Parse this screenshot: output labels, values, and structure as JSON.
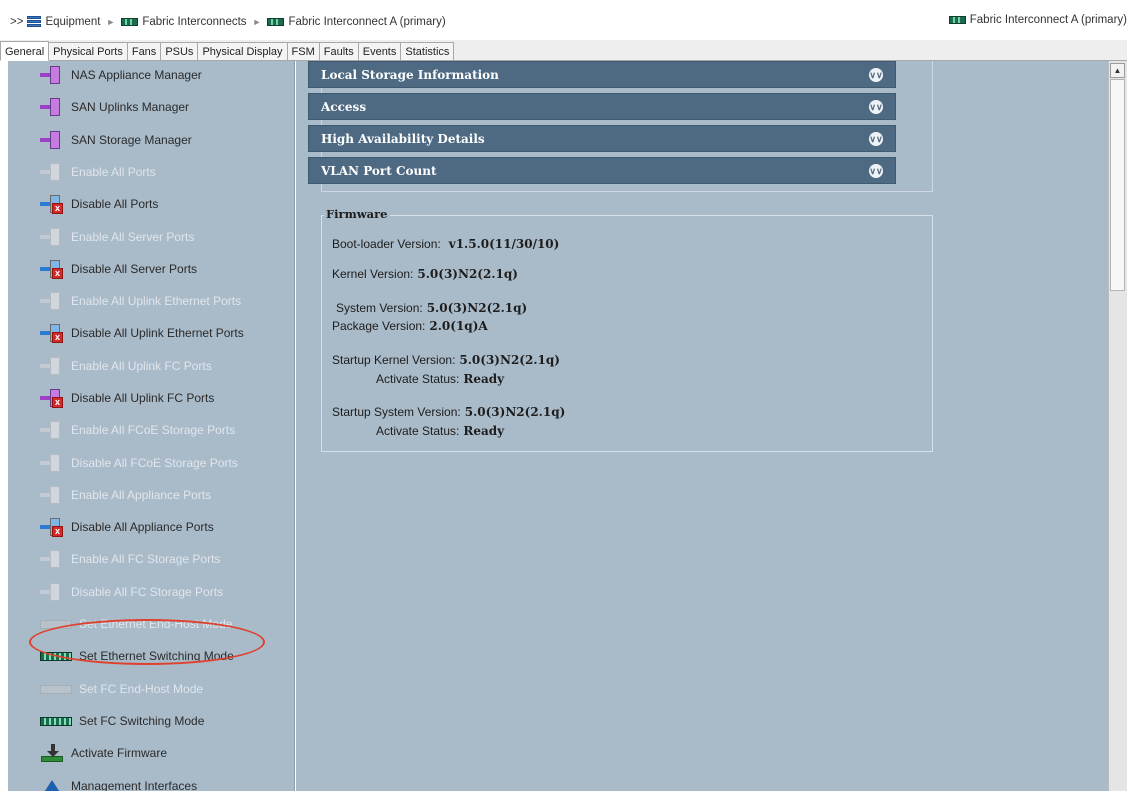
{
  "breadcrumb": {
    "prefix": ">>",
    "items": [
      "Equipment",
      "Fabric Interconnects",
      "Fabric Interconnect A (primary)"
    ],
    "right_title": "Fabric Interconnect A (primary)"
  },
  "tabs": [
    "General",
    "Physical Ports",
    "Fans",
    "PSUs",
    "Physical Display",
    "FSM",
    "Faults",
    "Events",
    "Statistics"
  ],
  "active_tab": "General",
  "actions": [
    {
      "label": "NAS Appliance Manager",
      "enabled": true,
      "icon": "manager-icon"
    },
    {
      "label": "SAN Uplinks Manager",
      "enabled": true,
      "icon": "manager-icon"
    },
    {
      "label": "SAN Storage Manager",
      "enabled": true,
      "icon": "manager-icon"
    },
    {
      "label": "Enable All Ports",
      "enabled": false,
      "icon": "port-icon"
    },
    {
      "label": "Disable All Ports",
      "enabled": true,
      "icon": "port-disable-icon"
    },
    {
      "label": "Enable All Server Ports",
      "enabled": false,
      "icon": "port-icon"
    },
    {
      "label": "Disable All Server Ports",
      "enabled": true,
      "icon": "port-disable-icon"
    },
    {
      "label": "Enable All Uplink Ethernet Ports",
      "enabled": false,
      "icon": "port-icon"
    },
    {
      "label": "Disable All Uplink Ethernet Ports",
      "enabled": true,
      "icon": "port-disable-icon"
    },
    {
      "label": "Enable All Uplink FC Ports",
      "enabled": false,
      "icon": "port-icon"
    },
    {
      "label": "Disable All Uplink FC Ports",
      "enabled": true,
      "icon": "port-disable-icon"
    },
    {
      "label": "Enable All FCoE Storage Ports",
      "enabled": false,
      "icon": "port-icon"
    },
    {
      "label": "Disable All FCoE Storage Ports",
      "enabled": false,
      "icon": "port-disable-icon"
    },
    {
      "label": "Enable All Appliance Ports",
      "enabled": false,
      "icon": "port-icon"
    },
    {
      "label": "Disable All Appliance Ports",
      "enabled": true,
      "icon": "port-disable-icon"
    },
    {
      "label": "Enable All FC Storage Ports",
      "enabled": false,
      "icon": "port-icon"
    },
    {
      "label": "Disable All FC Storage Ports",
      "enabled": false,
      "icon": "port-disable-icon"
    },
    {
      "label": "Set Ethernet End-Host Mode",
      "enabled": false,
      "icon": "switch-icon"
    },
    {
      "label": "Set Ethernet Switching Mode",
      "enabled": true,
      "icon": "switch-icon"
    },
    {
      "label": "Set FC End-Host Mode",
      "enabled": false,
      "icon": "switch-icon"
    },
    {
      "label": "Set FC Switching Mode",
      "enabled": true,
      "icon": "switch-icon"
    },
    {
      "label": "Activate Firmware",
      "enabled": true,
      "icon": "firmware-icon"
    },
    {
      "label": "Management Interfaces",
      "enabled": true,
      "icon": "management-icon"
    }
  ],
  "sections": [
    "Local Storage Information",
    "Access",
    "High Availability Details",
    "VLAN Port Count"
  ],
  "firmware": {
    "title": "Firmware",
    "boot_loader_label": "Boot-loader Version:",
    "boot_loader_value": "v1.5.0(11/30/10)",
    "kernel_label": "Kernel Version:",
    "kernel_value": "5.0(3)N2(2.1q)",
    "system_label": "System Version:",
    "system_value": "5.0(3)N2(2.1q)",
    "package_label": "Package Version:",
    "package_value": "2.0(1q)A",
    "startup_kernel_label": "Startup Kernel Version:",
    "startup_kernel_value": "5.0(3)N2(2.1q)",
    "activate_status_label_1": "Activate Status:",
    "activate_status_value_1": "Ready",
    "startup_system_label": "Startup System Version:",
    "startup_system_value": "5.0(3)N2(2.1q)",
    "activate_status_label_2": "Activate Status:",
    "activate_status_value_2": "Ready"
  },
  "colors": {
    "panel_bg": "#a9bac8",
    "section_header": "#4d6a82",
    "highlight_ring": "#e0402e",
    "disabled_text": "#e0e6ec"
  }
}
